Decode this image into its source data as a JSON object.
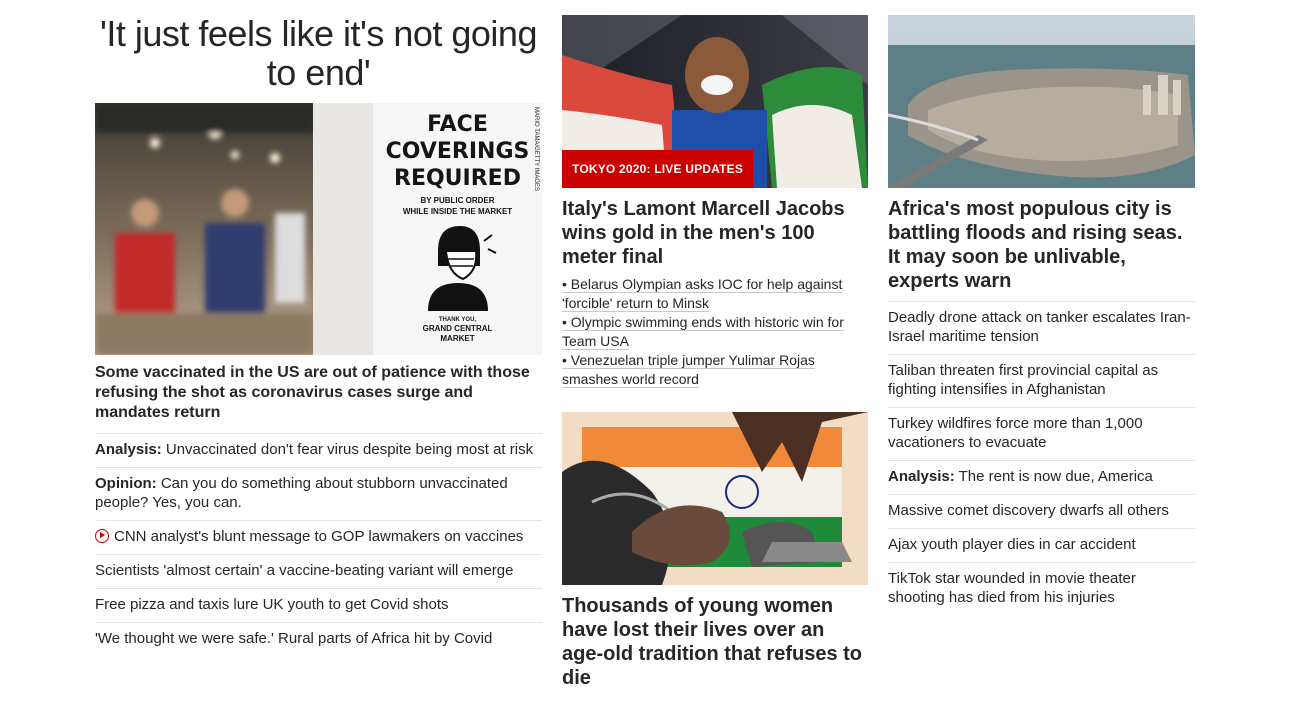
{
  "col1": {
    "headline": "'It just feels like it's not going to end'",
    "image_sign": {
      "line1": "FACE",
      "line2": "COVERINGS",
      "line3": "REQUIRED",
      "line4": "BY PUBLIC ORDER",
      "line5": "WHILE INSIDE THE MARKET",
      "thanks": "THANK YOU,",
      "market1": "GRAND CENTRAL",
      "market2": "MARKET",
      "credit": "MARIO TAMA/GETTY IMAGES"
    },
    "caption": "Some vaccinated in the US are out of patience with those refusing the shot as coronavirus cases surge and mandates return",
    "items": [
      {
        "kicker": "Analysis:",
        "text": "Unvaccinated don't fear virus despite being most at risk"
      },
      {
        "kicker": "Opinion:",
        "text": "Can you do something about stubborn unvaccinated people? Yes, you can."
      },
      {
        "kicker": "",
        "text": "CNN analyst's blunt message to GOP lawmakers on vaccines",
        "video": true
      },
      {
        "kicker": "",
        "text": "Scientists 'almost certain' a vaccine-beating variant will emerge"
      },
      {
        "kicker": "",
        "text": "Free pizza and taxis lure UK youth to get Covid shots"
      },
      {
        "kicker": "",
        "text": "'We thought we were safe.' Rural parts of Africa hit by Covid"
      }
    ]
  },
  "col2": {
    "badge": "TOKYO 2020: LIVE UPDATES",
    "title": "Italy's Lamont Marcell Jacobs wins gold in the men's 100 meter final",
    "bullets": [
      "• Belarus Olympian asks IOC for help against 'forcible' return to Minsk",
      "• Olympic swimming ends with historic win for Team USA",
      "• Venezuelan triple jumper Yulimar Rojas smashes world record"
    ],
    "second_title": "Thousands of young women have lost their lives over an age-old tradition that refuses to die"
  },
  "col3": {
    "title": "Africa's most populous city is battling floods and rising seas. It may soon be unlivable, experts warn",
    "items": [
      {
        "kicker": "",
        "text": "Deadly drone attack on tanker escalates Iran-Israel maritime tension"
      },
      {
        "kicker": "",
        "text": "Taliban threaten first provincial capital as fighting intensifies in Afghanistan"
      },
      {
        "kicker": "",
        "text": "Turkey wildfires force more than 1,000 vacationers to evacuate"
      },
      {
        "kicker": "Analysis:",
        "text": "The rent is now due, America"
      },
      {
        "kicker": "",
        "text": "Massive comet discovery dwarfs all others"
      },
      {
        "kicker": "",
        "text": "Ajax youth player dies in car accident"
      },
      {
        "kicker": "",
        "text": "TikTok star wounded in movie theater shooting has died from his injuries"
      }
    ]
  },
  "colors": {
    "accent_red": "#cc0000",
    "text": "#262626",
    "divider": "#e6e6e6"
  }
}
